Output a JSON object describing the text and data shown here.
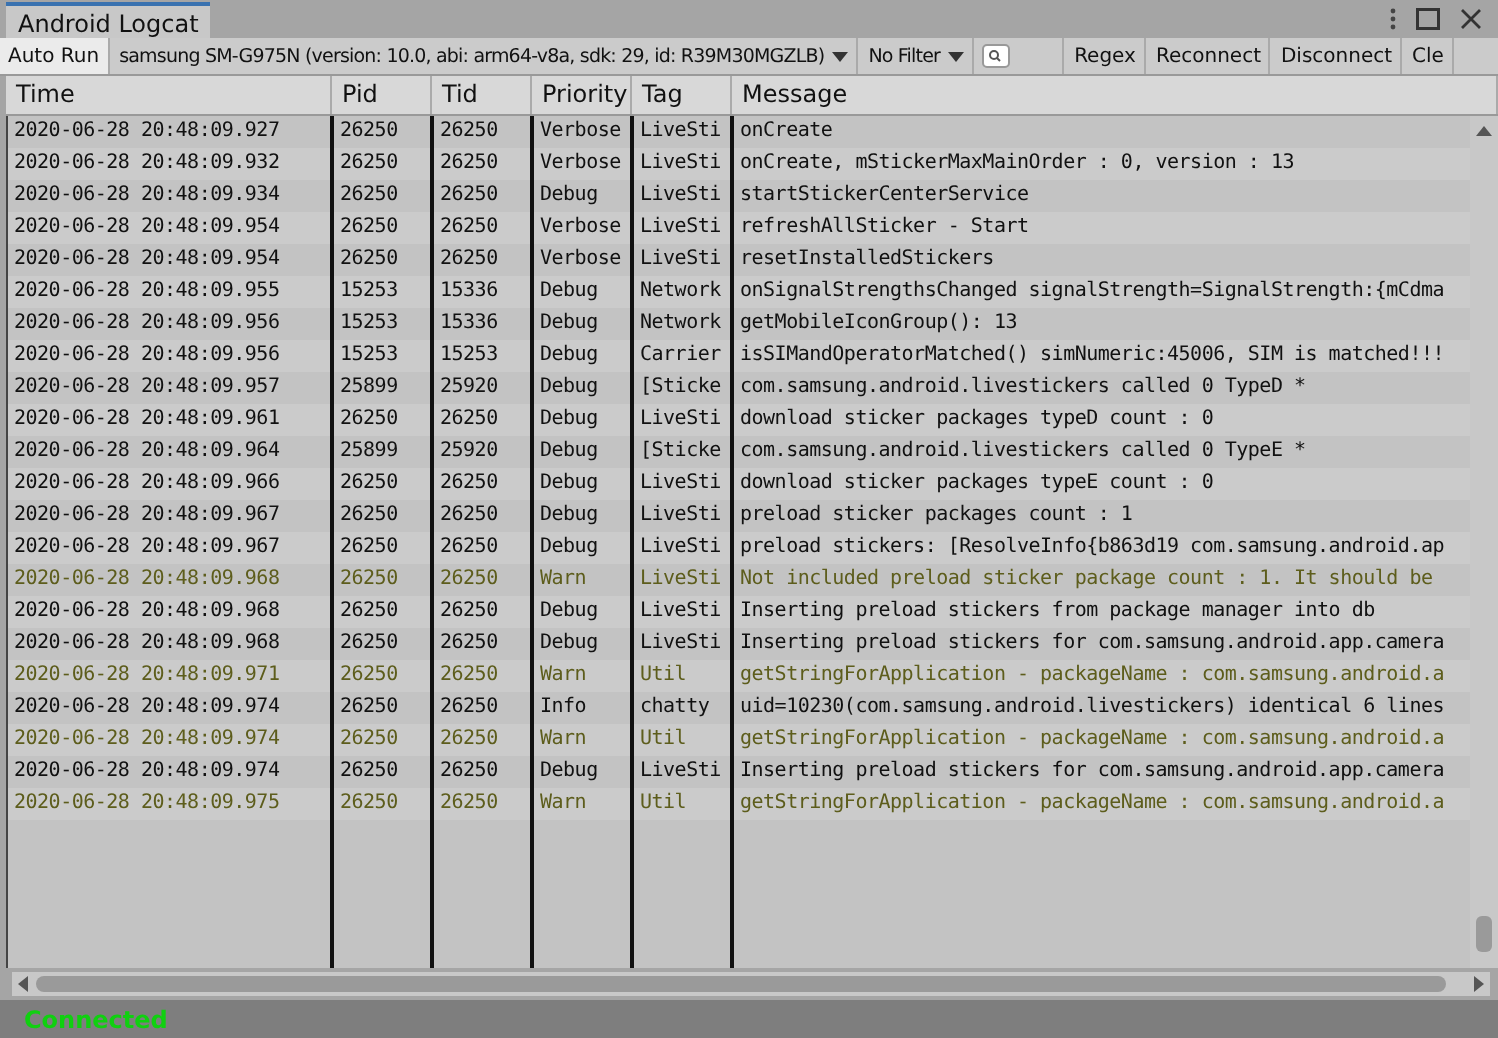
{
  "window": {
    "tab": "Android Logcat"
  },
  "toolbar": {
    "auto_run": {
      "label": "Auto Run",
      "on": true
    },
    "device": "samsung SM-G975N (version: 10.0, abi: arm64-v8a, sdk: 29, id: R39M30MGZLB)",
    "filter": "No Filter",
    "regex": {
      "label": "Regex",
      "on": false
    },
    "buttons": [
      "Reconnect",
      "Disconnect",
      "Cle"
    ]
  },
  "table": {
    "columns": [
      "Time",
      "Pid",
      "Tid",
      "Priority",
      "Tag",
      "Message"
    ],
    "rows": [
      {
        "kind": "normal",
        "time": "2020-06-28 20:48:09.927",
        "pid": "26250",
        "tid": "26250",
        "priority": "Verbose",
        "tag": "LiveSti",
        "message": "onCreate"
      },
      {
        "kind": "normal",
        "time": "2020-06-28 20:48:09.932",
        "pid": "26250",
        "tid": "26250",
        "priority": "Verbose",
        "tag": "LiveSti",
        "message": "onCreate, mStickerMaxMainOrder : 0, version : 13"
      },
      {
        "kind": "normal",
        "time": "2020-06-28 20:48:09.934",
        "pid": "26250",
        "tid": "26250",
        "priority": "Debug",
        "tag": "LiveSti",
        "message": "startStickerCenterService"
      },
      {
        "kind": "normal",
        "time": "2020-06-28 20:48:09.954",
        "pid": "26250",
        "tid": "26250",
        "priority": "Verbose",
        "tag": "LiveSti",
        "message": "refreshAllSticker - Start"
      },
      {
        "kind": "normal",
        "time": "2020-06-28 20:48:09.954",
        "pid": "26250",
        "tid": "26250",
        "priority": "Verbose",
        "tag": "LiveSti",
        "message": "resetInstalledStickers"
      },
      {
        "kind": "normal",
        "time": "2020-06-28 20:48:09.955",
        "pid": "15253",
        "tid": "15336",
        "priority": "Debug",
        "tag": "Network",
        "message": "onSignalStrengthsChanged signalStrength=SignalStrength:{mCdma"
      },
      {
        "kind": "normal",
        "time": "2020-06-28 20:48:09.956",
        "pid": "15253",
        "tid": "15336",
        "priority": "Debug",
        "tag": "Network",
        "message": "getMobileIconGroup(): 13"
      },
      {
        "kind": "normal",
        "time": "2020-06-28 20:48:09.956",
        "pid": "15253",
        "tid": "15253",
        "priority": "Debug",
        "tag": "Carrier",
        "message": "isSIMandOperatorMatched() simNumeric:45006, SIM is matched!!!"
      },
      {
        "kind": "normal",
        "time": "2020-06-28 20:48:09.957",
        "pid": "25899",
        "tid": "25920",
        "priority": "Debug",
        "tag": "[Sticke",
        "message": "com.samsung.android.livestickers called 0 TypeD *"
      },
      {
        "kind": "normal",
        "time": "2020-06-28 20:48:09.961",
        "pid": "26250",
        "tid": "26250",
        "priority": "Debug",
        "tag": "LiveSti",
        "message": "download sticker packages typeD count : 0"
      },
      {
        "kind": "normal",
        "time": "2020-06-28 20:48:09.964",
        "pid": "25899",
        "tid": "25920",
        "priority": "Debug",
        "tag": "[Sticke",
        "message": "com.samsung.android.livestickers called 0 TypeE *"
      },
      {
        "kind": "normal",
        "time": "2020-06-28 20:48:09.966",
        "pid": "26250",
        "tid": "26250",
        "priority": "Debug",
        "tag": "LiveSti",
        "message": "download sticker packages typeE count : 0"
      },
      {
        "kind": "normal",
        "time": "2020-06-28 20:48:09.967",
        "pid": "26250",
        "tid": "26250",
        "priority": "Debug",
        "tag": "LiveSti",
        "message": "preload sticker packages count : 1"
      },
      {
        "kind": "normal",
        "time": "2020-06-28 20:48:09.967",
        "pid": "26250",
        "tid": "26250",
        "priority": "Debug",
        "tag": "LiveSti",
        "message": "preload stickers: [ResolveInfo{b863d19 com.samsung.android.ap"
      },
      {
        "kind": "warn",
        "time": "2020-06-28 20:48:09.968",
        "pid": "26250",
        "tid": "26250",
        "priority": "Warn",
        "tag": "LiveSti",
        "message": "Not included preload sticker package count : 1. It should be"
      },
      {
        "kind": "normal",
        "time": "2020-06-28 20:48:09.968",
        "pid": "26250",
        "tid": "26250",
        "priority": "Debug",
        "tag": "LiveSti",
        "message": "Inserting preload stickers from package manager into db"
      },
      {
        "kind": "normal",
        "time": "2020-06-28 20:48:09.968",
        "pid": "26250",
        "tid": "26250",
        "priority": "Debug",
        "tag": "LiveSti",
        "message": "Inserting preload stickers for com.samsung.android.app.camera"
      },
      {
        "kind": "warn",
        "time": "2020-06-28 20:48:09.971",
        "pid": "26250",
        "tid": "26250",
        "priority": "Warn",
        "tag": "Util",
        "message": "getStringForApplication - packageName : com.samsung.android.a"
      },
      {
        "kind": "normal",
        "time": "2020-06-28 20:48:09.974",
        "pid": "26250",
        "tid": "26250",
        "priority": "Info",
        "tag": "chatty",
        "message": "uid=10230(com.samsung.android.livestickers) identical 6 lines"
      },
      {
        "kind": "warn",
        "time": "2020-06-28 20:48:09.974",
        "pid": "26250",
        "tid": "26250",
        "priority": "Warn",
        "tag": "Util",
        "message": "getStringForApplication - packageName : com.samsung.android.a"
      },
      {
        "kind": "normal",
        "time": "2020-06-28 20:48:09.974",
        "pid": "26250",
        "tid": "26250",
        "priority": "Debug",
        "tag": "LiveSti",
        "message": "Inserting preload stickers for com.samsung.android.app.camera"
      },
      {
        "kind": "warn",
        "time": "2020-06-28 20:48:09.975",
        "pid": "26250",
        "tid": "26250",
        "priority": "Warn",
        "tag": "Util",
        "message": "getStringForApplication - packageName : com.samsung.android.a"
      }
    ]
  },
  "status_bar": {
    "text": "Connected"
  }
}
